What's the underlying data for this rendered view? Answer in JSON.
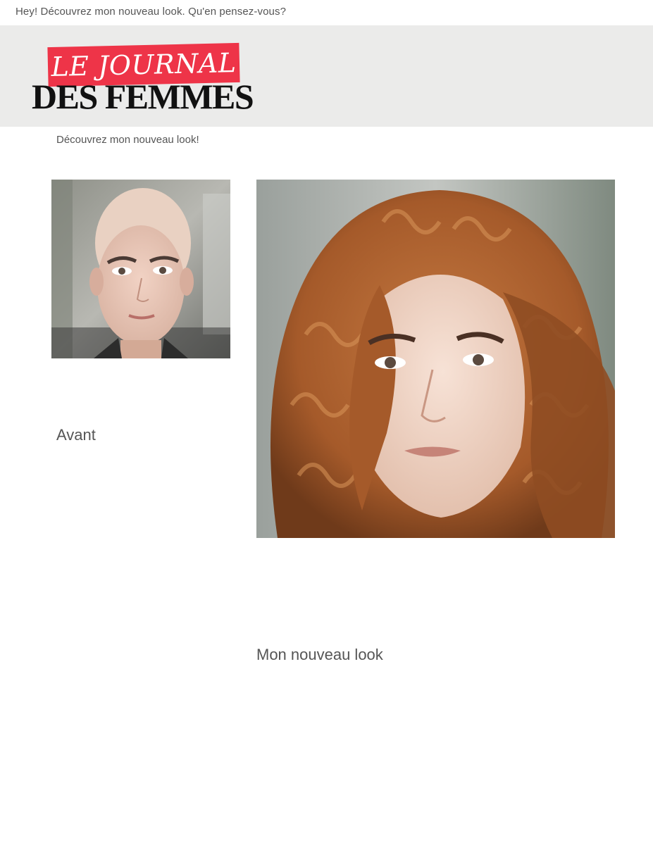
{
  "top_message": "Hey! Découvrez mon nouveau look. Qu'en pensez-vous?",
  "logo": {
    "line1": "LE JOURNAL",
    "line2": "DES FEMMES",
    "accent_color": "#ee3448"
  },
  "subtitle": "Découvrez mon nouveau look!",
  "before": {
    "caption": "Avant"
  },
  "after": {
    "caption": "Mon nouveau look"
  },
  "colors": {
    "header_background": "#ebebea",
    "text": "#555555",
    "hair": "#a55a2a"
  }
}
